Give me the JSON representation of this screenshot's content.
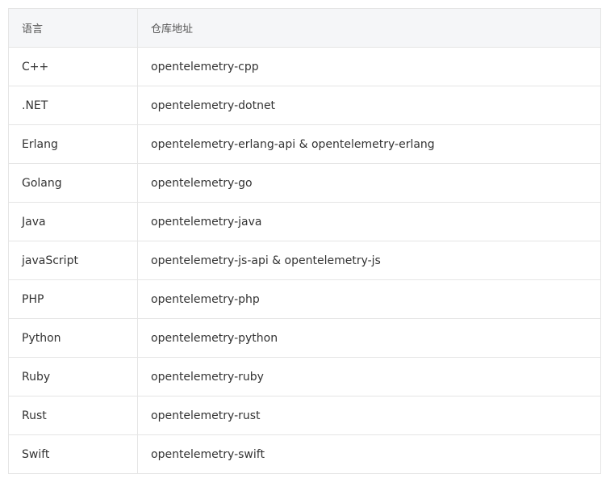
{
  "table": {
    "headers": [
      "语言",
      "仓库地址"
    ],
    "rows": [
      [
        "C++",
        "opentelemetry-cpp"
      ],
      [
        ".NET",
        "opentelemetry-dotnet"
      ],
      [
        "Erlang",
        "opentelemetry-erlang-api & opentelemetry-erlang"
      ],
      [
        "Golang",
        "opentelemetry-go"
      ],
      [
        "Java",
        "opentelemetry-java"
      ],
      [
        "javaScript",
        "opentelemetry-js-api & opentelemetry-js"
      ],
      [
        "PHP",
        "opentelemetry-php"
      ],
      [
        "Python",
        "opentelemetry-python"
      ],
      [
        "Ruby",
        "opentelemetry-ruby"
      ],
      [
        "Rust",
        "opentelemetry-rust"
      ],
      [
        "Swift",
        "opentelemetry-swift"
      ]
    ]
  }
}
